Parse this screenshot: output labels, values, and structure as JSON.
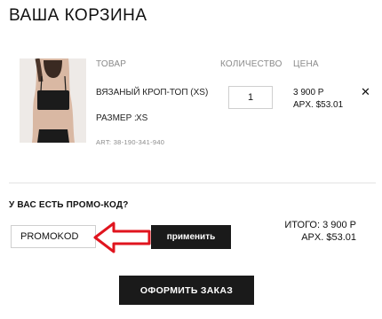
{
  "cart": {
    "title": "ВАША КОРЗИНА",
    "columns": {
      "product": "ТОВАР",
      "quantity": "КОЛИЧЕСТВО",
      "price": "ЦЕНА"
    },
    "item": {
      "name": "ВЯЗАНЫЙ КРОП-ТОП (XS)",
      "size_label": "РАЗМЕР :",
      "size_value": "XS",
      "art": "ART: 38-190-341-940",
      "quantity": "1",
      "price_rub": "3 900 Р",
      "price_usd": "APX. $53.01",
      "remove_icon": "close-icon"
    }
  },
  "promo": {
    "question": "У ВАС ЕСТЬ ПРОМО-КОД?",
    "code_value": "PROMOKOD",
    "apply_label": "применить",
    "arrow_color": "#e0141e"
  },
  "totals": {
    "rub": "ИТОГО: 3 900 Р",
    "usd": "APX. $53.01"
  },
  "checkout": {
    "label": "ОФОРМИТЬ ЗАКАЗ"
  }
}
